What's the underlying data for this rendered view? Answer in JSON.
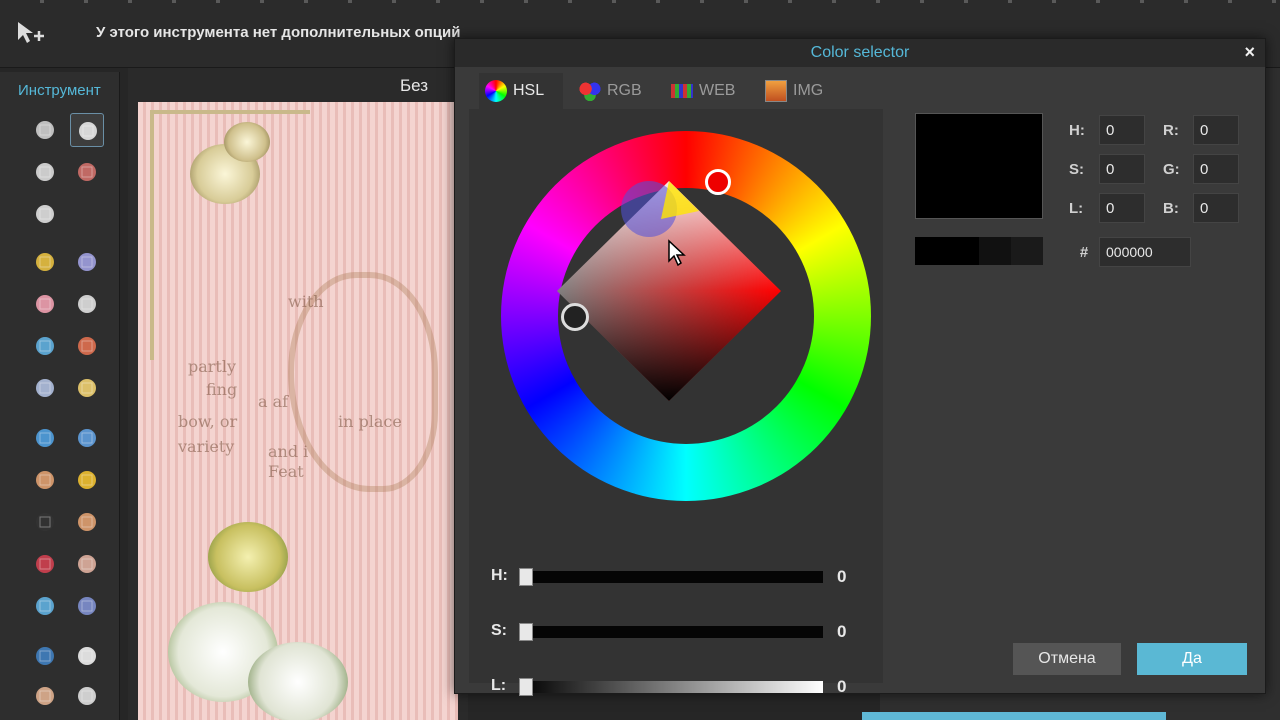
{
  "topbar": {
    "hint": "У этого инструмента нет дополнительных опций",
    "tool_icon": "move-icon"
  },
  "tools_panel": {
    "title": "Инструмент",
    "tools": [
      "crop-icon",
      "move-icon",
      "marquee-icon",
      "lasso-icon",
      "magic-wand-icon",
      "pencil-icon",
      "brush-icon",
      "eraser-icon",
      "bucket-icon",
      "gradient-icon",
      "stamp-icon",
      "color-replace-icon",
      "drawing-icon",
      "blur-icon",
      "sharpen-icon",
      "smudge-icon",
      "sponge-icon",
      "dodge-icon",
      "burn-icon",
      "red-eye-icon",
      "spot-heal-icon",
      "bloat-icon",
      "pinch-icon",
      "color-picker-icon",
      "type-icon",
      "hand-icon",
      "zoom-icon"
    ]
  },
  "document": {
    "tab_label": "Без",
    "canvas_text": [
      "with",
      "partly",
      "fing",
      "bow, or",
      "variety",
      "a af",
      "and i",
      "Feat",
      "in place"
    ]
  },
  "dialog": {
    "title": "Color selector",
    "close": "×",
    "tabs": [
      {
        "label": "HSL",
        "icon": "hsl-icon"
      },
      {
        "label": "RGB",
        "icon": "rgb-icon"
      },
      {
        "label": "WEB",
        "icon": "web-icon"
      },
      {
        "label": "IMG",
        "icon": "img-icon"
      }
    ],
    "sliders": [
      {
        "label": "H:",
        "value": "0"
      },
      {
        "label": "S:",
        "value": "0"
      },
      {
        "label": "L:",
        "value": "0"
      }
    ],
    "hsl_fields": [
      {
        "label": "H:",
        "value": "0"
      },
      {
        "label": "S:",
        "value": "0"
      },
      {
        "label": "L:",
        "value": "0"
      }
    ],
    "rgb_fields": [
      {
        "label": "R:",
        "value": "0"
      },
      {
        "label": "G:",
        "value": "0"
      },
      {
        "label": "B:",
        "value": "0"
      }
    ],
    "hex": {
      "label": "#",
      "value": "000000"
    },
    "preview_color": "#000000",
    "cancel_label": "Отмена",
    "ok_label": "Да"
  },
  "colors": {
    "accent": "#55b8d8",
    "ok_button": "#5ab8d4"
  }
}
